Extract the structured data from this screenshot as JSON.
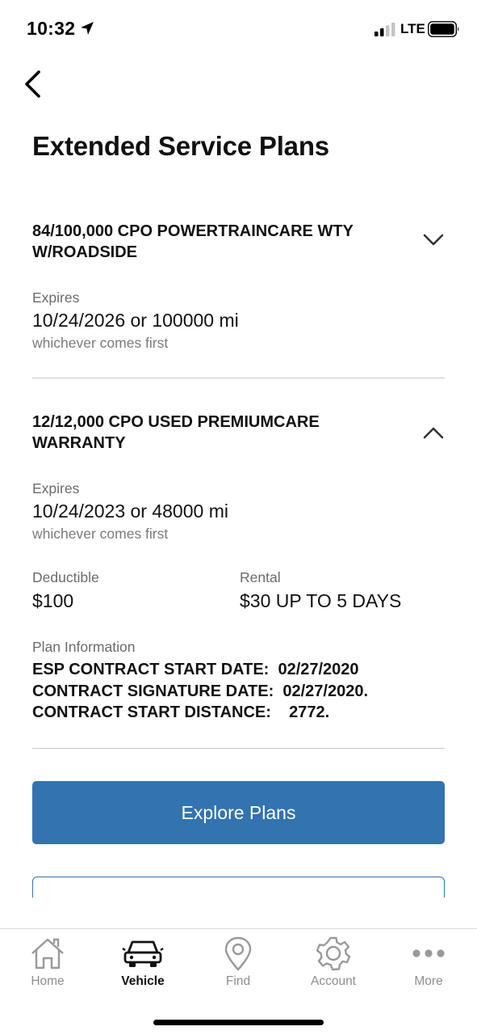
{
  "status_bar": {
    "time": "10:32",
    "network": "LTE"
  },
  "page": {
    "title": "Extended Service Plans"
  },
  "plans": [
    {
      "name": "84/100,000 CPO POWERTRAINCARE WTY W/ROADSIDE",
      "expanded": false,
      "expires_label": "Expires",
      "expires_value": "10/24/2026 or 100000 mi",
      "expires_note": "whichever comes first"
    },
    {
      "name": "12/12,000 CPO USED PREMIUMCARE WARRANTY",
      "expanded": true,
      "expires_label": "Expires",
      "expires_value": "10/24/2023 or 48000 mi",
      "expires_note": "whichever comes first",
      "deductible_label": "Deductible",
      "deductible_value": "$100",
      "rental_label": "Rental",
      "rental_value": "$30 UP TO 5 DAYS",
      "plan_info_label": "Plan Information",
      "plan_info_text": "ESP CONTRACT START DATE:  02/27/2020\nCONTRACT SIGNATURE DATE:  02/27/2020.\nCONTRACT START DISTANCE:    2772."
    }
  ],
  "actions": {
    "explore_label": "Explore Plans"
  },
  "tab_bar": {
    "active": "Vehicle",
    "tabs": [
      {
        "label": "Home",
        "icon": "home-icon"
      },
      {
        "label": "Vehicle",
        "icon": "car-icon"
      },
      {
        "label": "Find",
        "icon": "location-pin-icon"
      },
      {
        "label": "Account",
        "icon": "gear-icon"
      },
      {
        "label": "More",
        "icon": "more-dots-icon"
      }
    ]
  },
  "colors": {
    "accent": "#3273b0",
    "text": "#111111",
    "muted": "#6b6b6b",
    "divider": "#c8c8c8"
  }
}
